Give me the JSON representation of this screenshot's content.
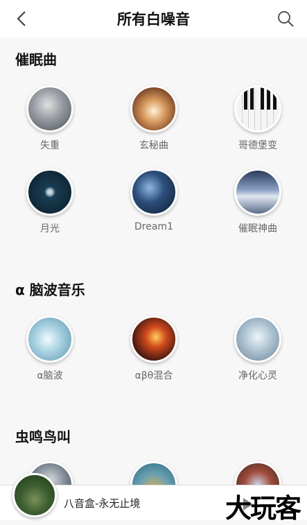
{
  "header": {
    "title": "所有白噪音",
    "back_icon": "back-chevron-icon",
    "search_icon": "search-icon"
  },
  "sections": [
    {
      "title": "催眠曲",
      "items": [
        {
          "label": "失重",
          "color": "#8a8f96"
        },
        {
          "label": "玄秘曲",
          "color": "#b07a4a"
        },
        {
          "label": "哥德堡变",
          "color": "#e8e8e8"
        },
        {
          "label": "月光",
          "color": "#0e2b3c"
        },
        {
          "label": "Dream1",
          "color": "#233a5c"
        },
        {
          "label": "催眠神曲",
          "color": "#6a7fa0"
        }
      ]
    },
    {
      "title": "α 脑波音乐",
      "items": [
        {
          "label": "α脑波",
          "color": "#7fb3c7"
        },
        {
          "label": "αβθ混合",
          "color": "#8a3a20"
        },
        {
          "label": "净化心灵",
          "color": "#9cb4c6"
        }
      ]
    },
    {
      "title": "虫鸣鸟叫",
      "items": []
    }
  ],
  "player": {
    "track": "八音盒-永无止境",
    "logo": "大玩客"
  }
}
